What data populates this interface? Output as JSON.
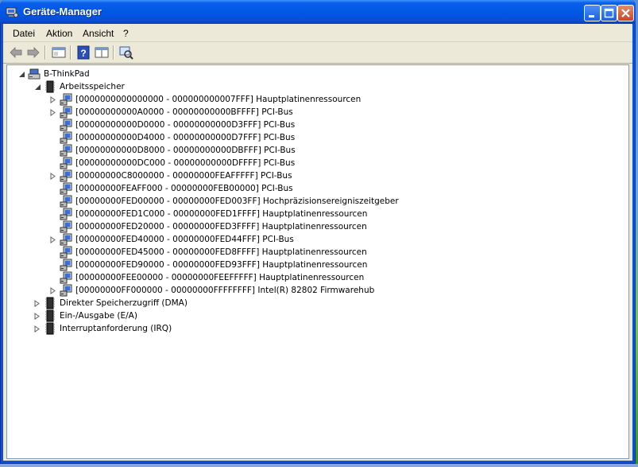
{
  "window": {
    "title": "Geräte-Manager"
  },
  "menu": {
    "items": [
      "Datei",
      "Aktion",
      "Ansicht",
      "?"
    ]
  },
  "toolbar": {
    "icons": [
      "back-arrow-icon",
      "forward-arrow-icon",
      "properties-window-icon",
      "help-icon",
      "view-icon",
      "scan-hardware-icon"
    ]
  },
  "tree": {
    "root": "B-ThinkPad",
    "category": "Arbeitsspeicher",
    "memory_ranges": [
      {
        "label": "[0000000000000000 - 000000000007FFF]  Hauptplatinenressourcen",
        "expandable": true
      },
      {
        "label": "[00000000000A0000 - 00000000000BFFFF]  PCI-Bus",
        "expandable": true
      },
      {
        "label": "[00000000000D0000 - 00000000000D3FFF]  PCI-Bus",
        "expandable": false
      },
      {
        "label": "[00000000000D4000 - 00000000000D7FFF]  PCI-Bus",
        "expandable": false
      },
      {
        "label": "[00000000000D8000 - 00000000000DBFFF]  PCI-Bus",
        "expandable": false
      },
      {
        "label": "[00000000000DC000 - 00000000000DFFFF]  PCI-Bus",
        "expandable": false
      },
      {
        "label": "[00000000C8000000 - 00000000FEAFFFFF]  PCI-Bus",
        "expandable": true
      },
      {
        "label": "[00000000FEAFF000 - 00000000FEB00000]  PCI-Bus",
        "expandable": false
      },
      {
        "label": "[00000000FED00000 - 00000000FED003FF]  Hochpräzisionsereigniszeitgeber",
        "expandable": false
      },
      {
        "label": "[00000000FED1C000 - 00000000FED1FFFF]  Hauptplatinenressourcen",
        "expandable": false
      },
      {
        "label": "[00000000FED20000 - 00000000FED3FFFF]  Hauptplatinenressourcen",
        "expandable": false
      },
      {
        "label": "[00000000FED40000 - 00000000FED44FFF]  PCI-Bus",
        "expandable": true
      },
      {
        "label": "[00000000FED45000 - 00000000FED8FFFF]  Hauptplatinenressourcen",
        "expandable": false
      },
      {
        "label": "[00000000FED90000 - 00000000FED93FFF]  Hauptplatinenressourcen",
        "expandable": false
      },
      {
        "label": "[00000000FEE00000 - 00000000FEEFFFFF]  Hauptplatinenressourcen",
        "expandable": false
      },
      {
        "label": "[00000000FF000000 - 00000000FFFFFFFF]  Intel(R) 82802 Firmwarehub",
        "expandable": true
      }
    ],
    "other_categories": [
      "Direkter Speicherzugriff (DMA)",
      "Ein-/Ausgabe (E/A)",
      "Interruptanforderung (IRQ)"
    ]
  }
}
